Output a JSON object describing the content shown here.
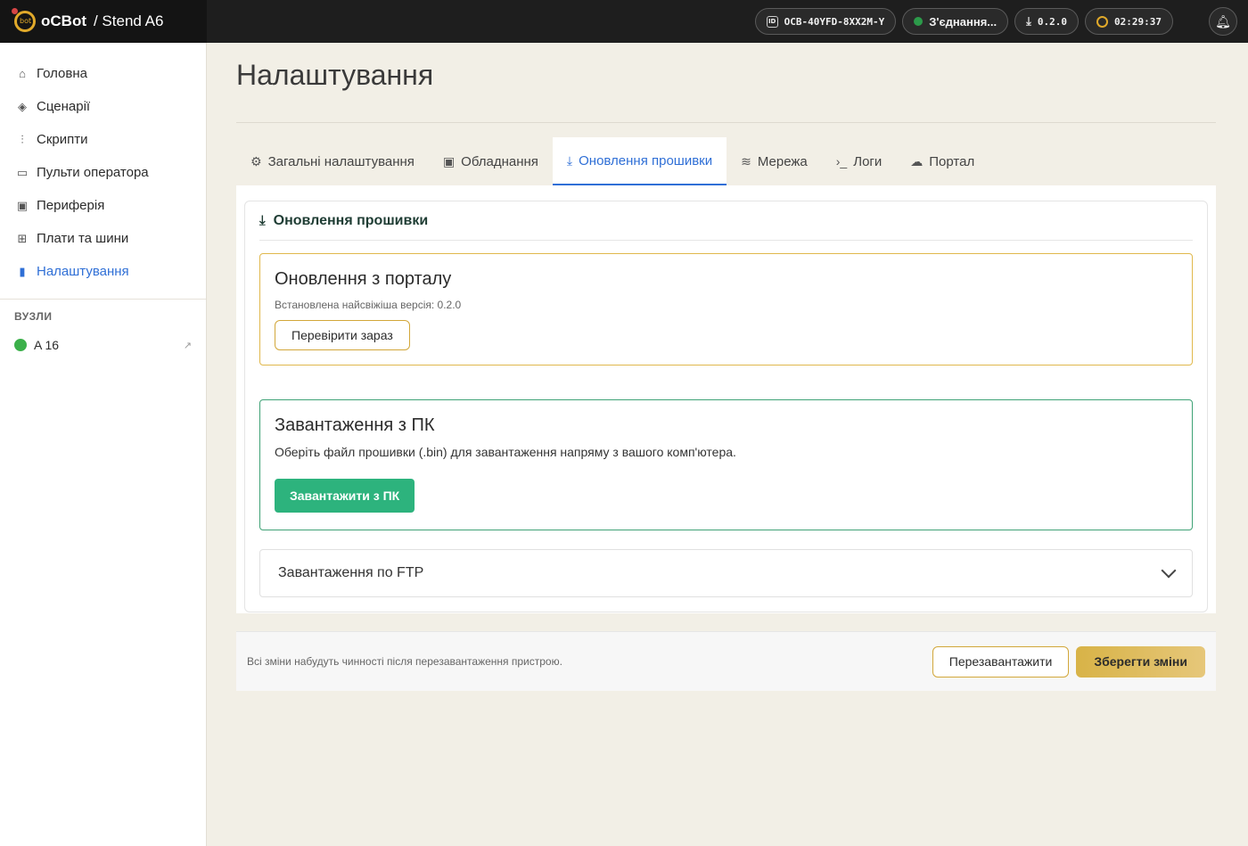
{
  "header": {
    "brand": "oCBot",
    "breadcrumb": "/ Stend A6",
    "device_id": "OCB-40YFD-8XX2M-Y",
    "connection_status": "З'єднання...",
    "version": "0.2.0",
    "uptime": "02:29:37",
    "status_color": "#2c9a4a"
  },
  "sidebar": {
    "items": [
      {
        "label": "Головна",
        "icon": "home-icon"
      },
      {
        "label": "Сценарії",
        "icon": "layers-icon"
      },
      {
        "label": "Скрипти",
        "icon": "sliders-icon"
      },
      {
        "label": "Пульти оператора",
        "icon": "monitor-icon"
      },
      {
        "label": "Периферія",
        "icon": "chip-icon"
      },
      {
        "label": "Плати та шини",
        "icon": "folder-icon"
      },
      {
        "label": "Налаштування",
        "icon": "bar-chart-icon"
      }
    ],
    "nodes_heading": "ВУЗЛИ",
    "nodes": [
      {
        "label": "A 16",
        "status_color": "#3bb04a"
      }
    ]
  },
  "main": {
    "title": "Налаштування",
    "tabs": [
      {
        "label": "Загальні налаштування"
      },
      {
        "label": "Обладнання"
      },
      {
        "label": "Оновлення прошивки"
      },
      {
        "label": "Мережа"
      },
      {
        "label": "Логи"
      },
      {
        "label": "Портал"
      }
    ],
    "active_tab": "Оновлення прошивки",
    "card_title": "Оновлення прошивки",
    "portal": {
      "title": "Оновлення з порталу",
      "subtitle": "Встановлена найсвіжіша версія: 0.2.0",
      "button": "Перевірити зараз"
    },
    "pc": {
      "title": "Завантаження з ПК",
      "description": "Оберіть файл прошивки (.bin) для завантаження напряму з вашого комп'ютера.",
      "button": "Завантажити з ПК"
    },
    "ftp": {
      "title": "Завантаження по FTP"
    }
  },
  "footer": {
    "note": "Всі зміни набудуть чинності після перезавантаження пристрою.",
    "reboot_button": "Перезавантажити",
    "save_button": "Зберегти зміни"
  }
}
